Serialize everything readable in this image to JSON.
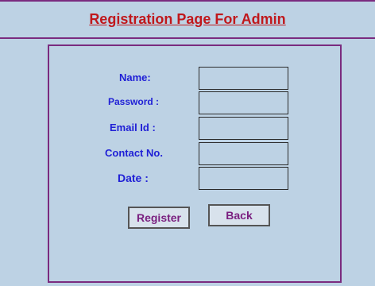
{
  "page": {
    "title": "Registration Page For Admin"
  },
  "form": {
    "fields": [
      {
        "label": "Name:",
        "value": ""
      },
      {
        "label": "Password :",
        "value": ""
      },
      {
        "label": "Email Id :",
        "value": ""
      },
      {
        "label": "Contact No.",
        "value": ""
      },
      {
        "label": "Date  :",
        "value": ""
      }
    ],
    "register_label": "Register",
    "back_label": "Back"
  },
  "colors": {
    "background": "#bdd2e4",
    "border": "#7a2b7f",
    "title": "#c0181c",
    "label": "#1f1fd6",
    "button_text": "#7a1f7f"
  }
}
